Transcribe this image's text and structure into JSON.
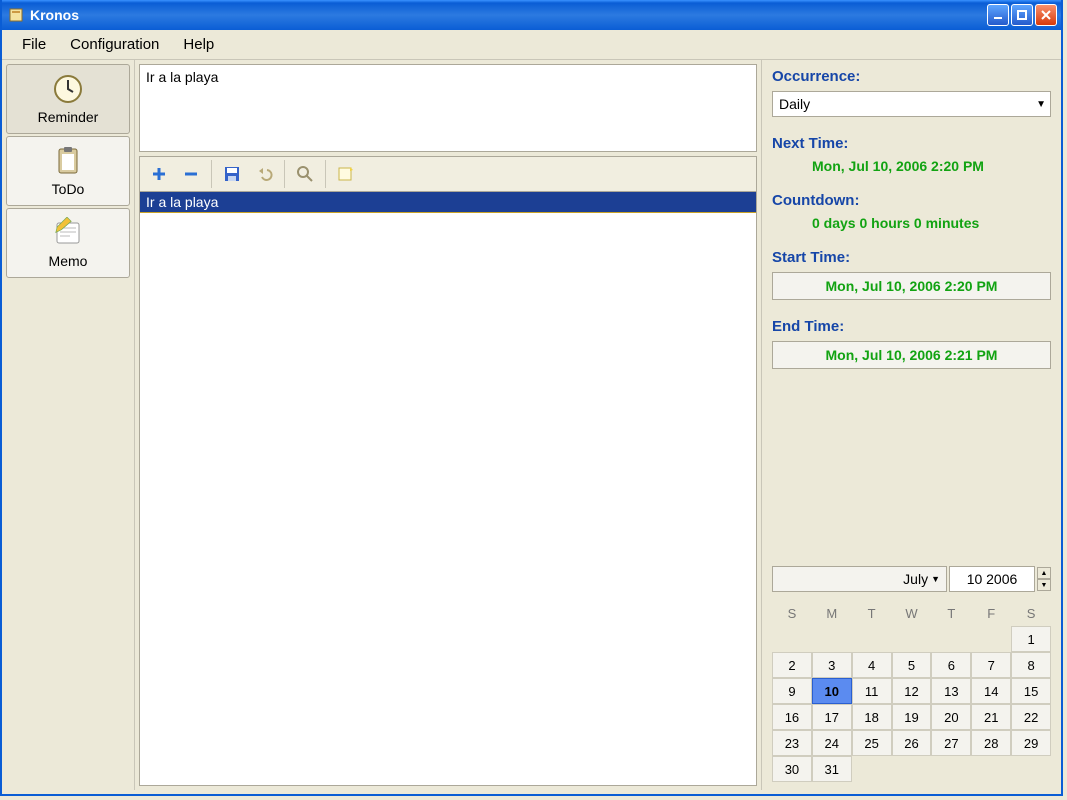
{
  "window": {
    "title": "Kronos"
  },
  "menubar": {
    "file": "File",
    "configuration": "Configuration",
    "help": "Help"
  },
  "sidebar": {
    "reminder": "Reminder",
    "todo": "ToDo",
    "memo": "Memo"
  },
  "note": {
    "text": "Ir a la playa"
  },
  "list": {
    "items": [
      "Ir a la playa"
    ]
  },
  "panel": {
    "occurrence_label": "Occurrence:",
    "occurrence_value": "Daily",
    "next_time_label": "Next Time:",
    "next_time_value": "Mon, Jul 10, 2006 2:20 PM",
    "countdown_label": "Countdown:",
    "countdown_value": "0 days 0 hours 0 minutes",
    "start_time_label": "Start Time:",
    "start_time_value": "Mon, Jul 10, 2006 2:20 PM",
    "end_time_label": "End Time:",
    "end_time_value": "Mon, Jul 10, 2006 2:21 PM"
  },
  "calendar": {
    "month": "July",
    "year": "10 2006",
    "dow": [
      "S",
      "M",
      "T",
      "W",
      "T",
      "F",
      "S"
    ],
    "days": [
      [
        "",
        "",
        "",
        "",
        "",
        "",
        "1"
      ],
      [
        "2",
        "3",
        "4",
        "5",
        "6",
        "7",
        "8"
      ],
      [
        "9",
        "10",
        "11",
        "12",
        "13",
        "14",
        "15"
      ],
      [
        "16",
        "17",
        "18",
        "19",
        "20",
        "21",
        "22"
      ],
      [
        "23",
        "24",
        "25",
        "26",
        "27",
        "28",
        "29"
      ],
      [
        "30",
        "31",
        "",
        "",
        "",
        "",
        ""
      ]
    ],
    "selected": "10"
  }
}
